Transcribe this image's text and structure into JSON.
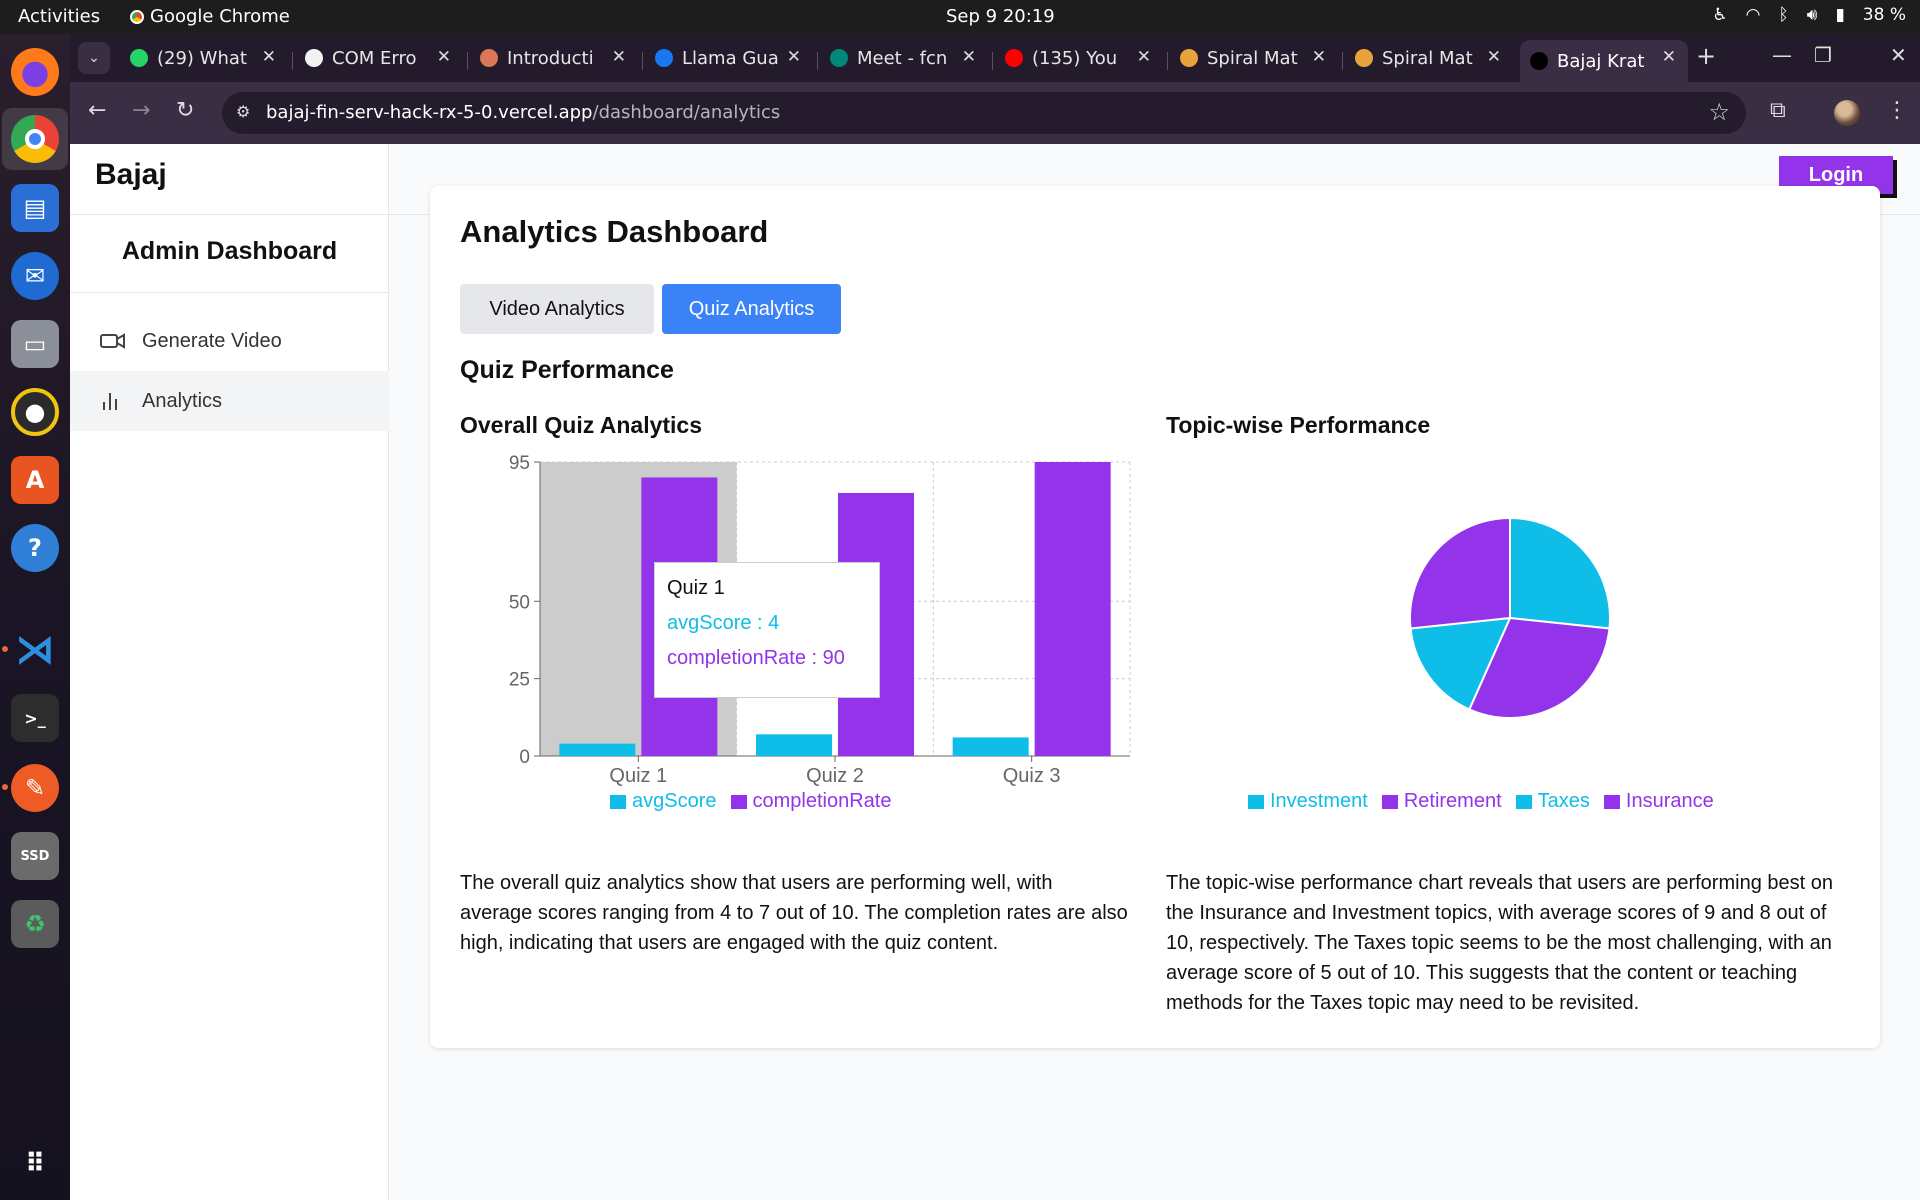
{
  "os": {
    "activities": "Activities",
    "app_name": "Google Chrome",
    "clock": "Sep 9  20:19",
    "battery": "38 %"
  },
  "browser": {
    "tabs": [
      {
        "title": "(29) What",
        "favicon_color": "#25d366"
      },
      {
        "title": "COM Erro",
        "favicon_color": "#f2f2f2"
      },
      {
        "title": "Introducti",
        "favicon_color": "#d97757"
      },
      {
        "title": "Llama Gua",
        "favicon_color": "#1877f2"
      },
      {
        "title": "Meet - fcn",
        "favicon_color": "#00897b"
      },
      {
        "title": "(135) You",
        "favicon_color": "#ff0000"
      },
      {
        "title": "Spiral Mat",
        "favicon_color": "#e8a33d"
      },
      {
        "title": "Spiral Mat",
        "favicon_color": "#e8a33d"
      },
      {
        "title": "Bajaj Krat",
        "favicon_color": "#000000"
      }
    ],
    "url_host": "bajaj-fin-serv-hack-rx-5-0.vercel.app",
    "url_path": "/dashboard/analytics"
  },
  "sidebar": {
    "brand": "Bajaj",
    "title": "Admin Dashboard",
    "items": [
      {
        "label": "Generate Video",
        "icon": "video-camera-icon"
      },
      {
        "label": "Analytics",
        "icon": "bar-chart-icon"
      }
    ]
  },
  "header": {
    "login_label": "Login"
  },
  "main": {
    "title": "Analytics Dashboard",
    "tabs": [
      {
        "label": "Video Analytics"
      },
      {
        "label": "Quiz Analytics"
      }
    ],
    "section_title": "Quiz Performance",
    "left_panel": {
      "title": "Overall Quiz Analytics",
      "description": "The overall quiz analytics show that users are performing well, with average scores ranging from 4 to 7 out of 10. The completion rates are also high, indicating that users are engaged with the quiz content."
    },
    "right_panel": {
      "title": "Topic-wise Performance",
      "description": "The topic-wise performance chart reveals that users are performing best on the Insurance and Investment topics, with average scores of 9 and 8 out of 10, respectively. The Taxes topic seems to be the most challenging, with an average score of 5 out of 10. This suggests that the content or teaching methods for the Taxes topic may need to be revisited."
    },
    "tooltip": {
      "title": "Quiz 1",
      "line1": "avgScore : 4",
      "line2": "completionRate : 90"
    }
  },
  "colors": {
    "avg": "#0ebde8",
    "completion": "#9333ea",
    "accent_blue": "#3b82f6",
    "login_purple": "#9333ea"
  },
  "chart_data": [
    {
      "type": "bar",
      "categories": [
        "Quiz 1",
        "Quiz 2",
        "Quiz 3"
      ],
      "series": [
        {
          "name": "avgScore",
          "values": [
            4,
            7,
            6
          ],
          "color": "#0ebde8"
        },
        {
          "name": "completionRate",
          "values": [
            90,
            85,
            95
          ],
          "color": "#9333ea"
        }
      ],
      "yticks": [
        0,
        25,
        50,
        95
      ],
      "ylim": [
        0,
        95
      ],
      "grid": true,
      "legend": "bottom",
      "highlighted_category": "Quiz 1"
    },
    {
      "type": "pie",
      "categories": [
        "Investment",
        "Retirement",
        "Taxes",
        "Insurance"
      ],
      "values": [
        8,
        9,
        5,
        8
      ],
      "colors": [
        "#0ebde8",
        "#9333ea",
        "#0ebde8",
        "#9333ea"
      ],
      "legend": "bottom"
    }
  ]
}
